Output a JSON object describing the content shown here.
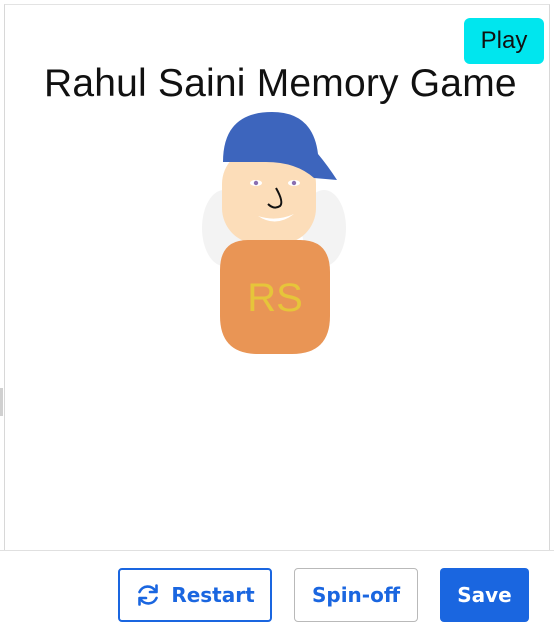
{
  "game": {
    "play_label": "Play",
    "title": "Rahul Saini Memory Game",
    "sprite_initials": "RS"
  },
  "toolbar": {
    "restart_label": "Restart",
    "spinoff_label": "Spin-off",
    "save_label": "Save",
    "restart_icon": "refresh-icon"
  },
  "colors": {
    "play_button": "#00e6ee",
    "accent": "#1a66e0",
    "sprite_shirt": "#e99555",
    "sprite_cap": "#3d65bd",
    "sprite_initials": "#e6c53a"
  }
}
